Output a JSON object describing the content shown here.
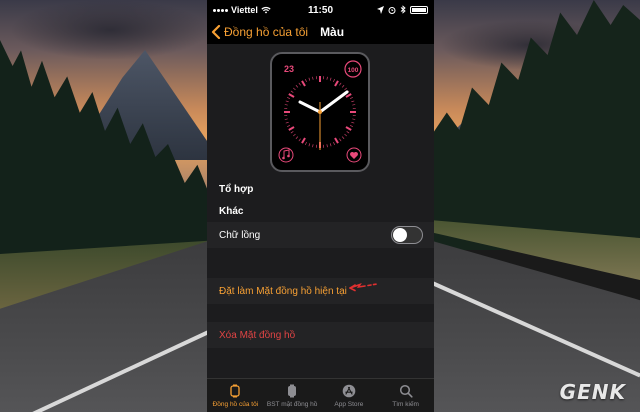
{
  "status_bar": {
    "carrier": "Viettel",
    "time": "11:50"
  },
  "nav": {
    "back_label": "Đồng hồ của tôi",
    "title": "Màu"
  },
  "watch_face": {
    "complication_top_left": "23",
    "complication_top_right": "100",
    "accent_color": "#e8497a",
    "second_hand_color": "#f7a034"
  },
  "sections": {
    "to_hop": "Tổ hợp",
    "khac": "Khác"
  },
  "rows": {
    "chu_long": {
      "label": "Chữ lồng",
      "toggle_on": false
    },
    "set_current": "Đặt làm Mặt đồng hồ hiện tại",
    "delete": "Xóa Mặt đồng hồ"
  },
  "tabs": [
    {
      "label": "Đồng hồ của tôi",
      "active": true
    },
    {
      "label": "BST mặt đồng hồ",
      "active": false
    },
    {
      "label": "App Store",
      "active": false
    },
    {
      "label": "Tìm kiếm",
      "active": false
    }
  ],
  "logo": "GENK",
  "colors": {
    "ios_orange": "#f7a034",
    "destructive_red": "#e04444"
  }
}
